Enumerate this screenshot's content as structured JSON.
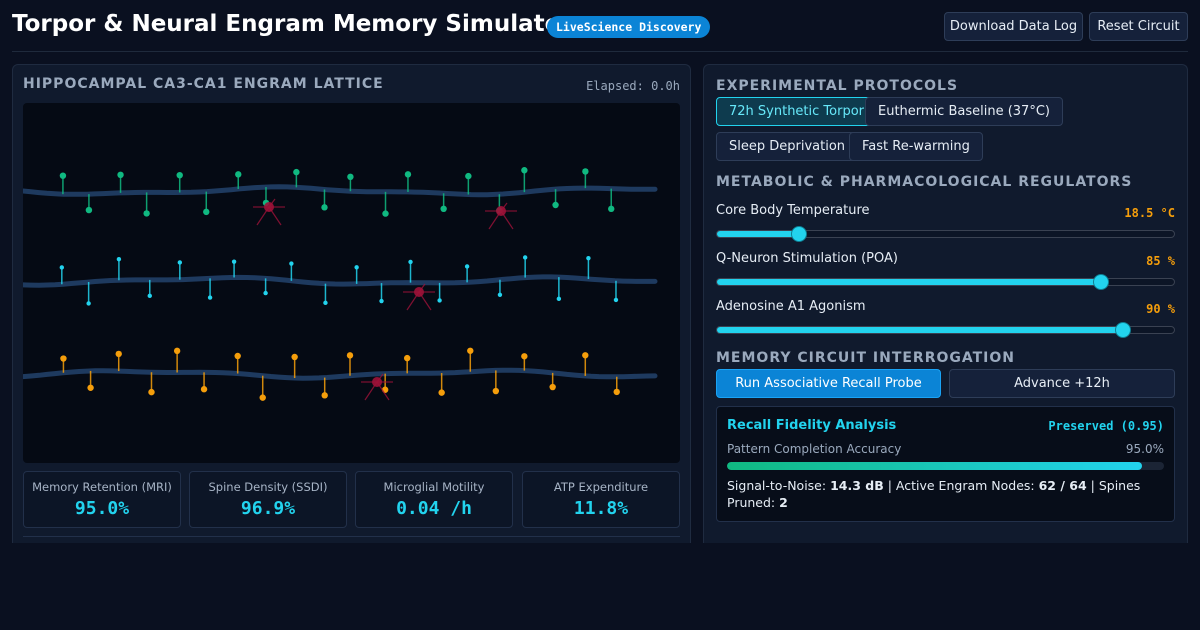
{
  "header": {
    "title": "Torpor & Neural Engram Memory Simulator",
    "badge": "LiveScience Discovery",
    "download_label": "Download Data Log",
    "reset_label": "Reset Circuit"
  },
  "lattice": {
    "title": "HIPPOCAMPAL CA3-CA1 ENGRAM LATTICE",
    "elapsed": "Elapsed: 0.0h",
    "rows": [
      {
        "spine_color": "#10b981",
        "spines": 20
      },
      {
        "spine_color": "#22d3ee",
        "spines": 20
      },
      {
        "spine_color": "#f59e0b",
        "spines": 20
      }
    ],
    "microglia_color": "#9f1239"
  },
  "metrics": [
    {
      "label": "Memory Retention (MRI)",
      "value": "95.0%"
    },
    {
      "label": "Spine Density (SSDI)",
      "value": "96.9%"
    },
    {
      "label": "Microglial Motility",
      "value": "0.04 /h"
    },
    {
      "label": "ATP Expenditure",
      "value": "11.8%"
    }
  ],
  "protocols": {
    "title": "EXPERIMENTAL PROTOCOLS",
    "items": [
      {
        "label": "72h Synthetic Torpor",
        "active": true
      },
      {
        "label": "Euthermic Baseline (37°C)",
        "active": false
      },
      {
        "label": "Sleep Deprivation",
        "active": false
      },
      {
        "label": "Fast Re-warming",
        "active": false
      }
    ]
  },
  "regulators": {
    "title": "METABOLIC & PHARMACOLOGICAL REGULATORS",
    "sliders": [
      {
        "label": "Core Body Temperature",
        "value": "18.5 °C",
        "level": 0.17
      },
      {
        "label": "Q-Neuron Stimulation (POA)",
        "value": "85 %",
        "level": 0.85
      },
      {
        "label": "Adenosine A1 Agonism",
        "value": "90 %",
        "level": 0.9
      }
    ]
  },
  "interrogation": {
    "title": "MEMORY CIRCUIT INTERROGATION",
    "run_label": "Run Associative Recall Probe",
    "advance_label": "Advance +12h"
  },
  "recall": {
    "title": "Recall Fidelity Analysis",
    "status": "Preserved (0.95)",
    "accuracy_label": "Pattern Completion Accuracy",
    "accuracy_value": "95.0%",
    "accuracy_level": 0.95,
    "snr_label": "Signal-to-Noise:",
    "snr_value": "14.3 dB",
    "nodes_label": "Active Engram Nodes:",
    "nodes_value": "62 / 64",
    "pruned_label": "Spines Pruned:",
    "pruned_value": "2"
  },
  "colors": {
    "accent": "#22d3ee",
    "primary_button": "#0b84d6",
    "warning": "#f59e0b",
    "background": "#0a1020"
  }
}
